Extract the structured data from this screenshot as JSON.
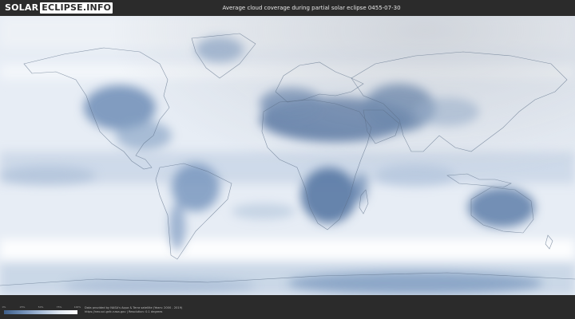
{
  "header": {
    "logo_part1": "SOLAR",
    "logo_part2": "ECLIPSE.INFO",
    "title": "Average cloud coverage during partial solar eclipse 0455-07-30"
  },
  "legend": {
    "ticks": [
      "0%",
      "25%",
      "50%",
      "75%",
      "100%"
    ],
    "colors": [
      "#3f5f8a",
      "#6f8db5",
      "#a7bcd8",
      "#dfe7f1",
      "#ffffff"
    ]
  },
  "footer": {
    "credit_line1": "Data provided by NASA's Aqua & Terra satellite (Years: 2000 - 2019)",
    "credit_line2": "https://neo.sci.gsfc.nasa.gov  |  Resolution: 0.1 degrees"
  },
  "colors": {
    "background": "#2b2b2b",
    "clear_sky": "#3f5f8a",
    "full_cloud": "#ffffff",
    "night_shade": "#c9ced6"
  }
}
